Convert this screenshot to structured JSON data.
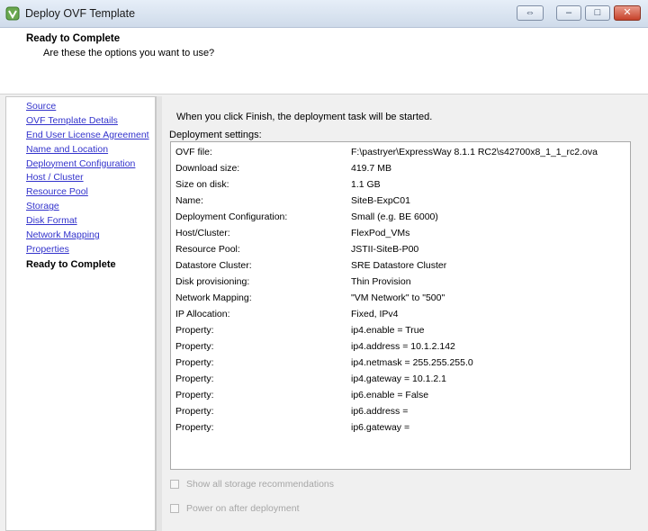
{
  "window": {
    "title": "Deploy OVF Template",
    "buttons": {
      "restore": "⇔",
      "minimize": "‒",
      "maximize": "□",
      "close": "✕"
    }
  },
  "header": {
    "title": "Ready to Complete",
    "subtitle": "Are these the options you want to use?"
  },
  "sidebar": {
    "items": [
      {
        "label": "Source"
      },
      {
        "label": "OVF Template Details"
      },
      {
        "label": "End User License Agreement"
      },
      {
        "label": "Name and Location"
      },
      {
        "label": "Deployment Configuration"
      },
      {
        "label": "Host / Cluster"
      },
      {
        "label": "Resource Pool"
      },
      {
        "label": "Storage"
      },
      {
        "label": "Disk Format"
      },
      {
        "label": "Network Mapping"
      },
      {
        "label": "Properties"
      }
    ],
    "current": "Ready to Complete"
  },
  "main": {
    "intro": "When you click Finish, the deployment task will be started.",
    "settings_label": "Deployment settings:",
    "rows": [
      {
        "key": "OVF file:",
        "value": "F:\\pastryer\\ExpressWay 8.1.1 RC2\\s42700x8_1_1_rc2.ova"
      },
      {
        "key": "Download size:",
        "value": "419.7 MB"
      },
      {
        "key": "Size on disk:",
        "value": "1.1 GB"
      },
      {
        "key": "Name:",
        "value": "SiteB-ExpC01"
      },
      {
        "key": "Deployment Configuration:",
        "value": "Small (e.g. BE 6000)"
      },
      {
        "key": "Host/Cluster:",
        "value": "FlexPod_VMs"
      },
      {
        "key": "Resource Pool:",
        "value": "JSTII-SiteB-P00"
      },
      {
        "key": "Datastore Cluster:",
        "value": "SRE Datastore Cluster"
      },
      {
        "key": "Disk provisioning:",
        "value": "Thin Provision"
      },
      {
        "key": "Network Mapping:",
        "value": "\"VM Network\" to \"500\""
      },
      {
        "key": "IP Allocation:",
        "value": "Fixed, IPv4"
      },
      {
        "key": "Property:",
        "value": "ip4.enable = True"
      },
      {
        "key": "Property:",
        "value": "ip4.address = 10.1.2.142"
      },
      {
        "key": "Property:",
        "value": "ip4.netmask = 255.255.255.0"
      },
      {
        "key": "Property:",
        "value": "ip4.gateway = 10.1.2.1"
      },
      {
        "key": "Property:",
        "value": "ip6.enable = False"
      },
      {
        "key": "Property:",
        "value": "ip6.address ="
      },
      {
        "key": "Property:",
        "value": "ip6.gateway ="
      }
    ],
    "checkboxes": [
      {
        "label": "Show all storage recommendations",
        "checked": false,
        "enabled": false
      },
      {
        "label": "Power on after deployment",
        "checked": false,
        "enabled": false
      }
    ]
  }
}
